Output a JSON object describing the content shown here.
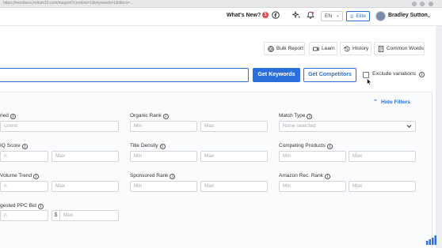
{
  "browser": {
    "url": "https://members.helium10.com/magnet?cerebro=1&keywords=1&filters=..."
  },
  "topnav": {
    "whats_new": "What's New?",
    "badge_count": "1",
    "language": "EN",
    "plan": "Elite",
    "username": "Bradley Sutton"
  },
  "toolbar": {
    "bulk_report": "Bulk Report",
    "learn": "Learn",
    "history": "History",
    "common_words": "Common Words"
  },
  "search": {
    "value": "",
    "get_keywords": "Get Keywords",
    "get_competitors": "Get Competitors",
    "exclude_variations": "Exclude variations"
  },
  "filters": {
    "hide_filters": "Hide Filters",
    "queried_label": "ried",
    "queried_placeholder": "urrent",
    "organic_rank": {
      "label": "Organic Rank",
      "min": "Min",
      "max": "Max"
    },
    "match_type": {
      "label": "Match Type",
      "value": "None selected"
    },
    "iq_score": {
      "label": "IQ Score",
      "min": "n",
      "max": "Max"
    },
    "title_density": {
      "label": "Title Density",
      "min": "Min",
      "max": "Max"
    },
    "competing_products": {
      "label": "Competing Products",
      "min": "Min",
      "max": "Max"
    },
    "volume_trend": {
      "label": "Volume Trend",
      "min": "n",
      "max": "Max"
    },
    "sponsored_rank": {
      "label": "Sponsored Rank",
      "min": "Min",
      "max": "Max"
    },
    "amazon_rec_rank": {
      "label": "Amazon Rec. Rank",
      "min": "Min",
      "max": "Max"
    },
    "suggested_ppc_bid": {
      "label": "gested PPC Bid",
      "min": "n",
      "currency": "$",
      "max": "Max"
    }
  },
  "colors": {
    "accent": "#2a6fdb",
    "badge": "#e5484d"
  }
}
